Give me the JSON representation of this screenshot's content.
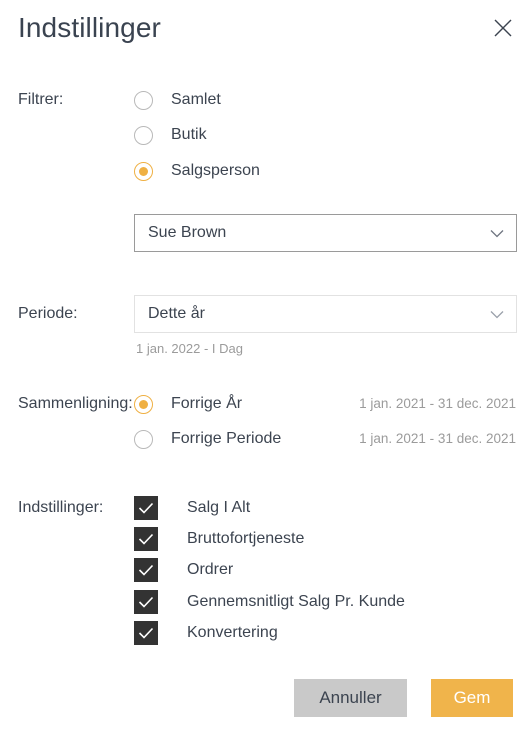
{
  "dialog": {
    "title": "Indstillinger",
    "close_icon": "close-icon"
  },
  "filter": {
    "label": "Filtrer:",
    "options": [
      {
        "label": "Samlet",
        "selected": false
      },
      {
        "label": "Butik",
        "selected": false
      },
      {
        "label": "Salgsperson",
        "selected": true
      }
    ],
    "salesperson_select": {
      "value": "Sue Brown",
      "chevron_icon": "chevron-down-icon"
    }
  },
  "period": {
    "label": "Periode:",
    "select": {
      "value": "Dette år",
      "chevron_icon": "chevron-down-icon"
    },
    "range_text": "1 jan. 2022 - I Dag"
  },
  "comparison": {
    "label": "Sammenligning:",
    "options": [
      {
        "label": "Forrige År",
        "range": "1 jan. 2021 - 31 dec. 2021",
        "selected": true
      },
      {
        "label": "Forrige Periode",
        "range": "1 jan. 2021 - 31 dec. 2021",
        "selected": false
      }
    ]
  },
  "settings": {
    "label": "Indstillinger:",
    "items": [
      {
        "label": "Salg I Alt",
        "checked": true
      },
      {
        "label": "Bruttofortjeneste",
        "checked": true
      },
      {
        "label": "Ordrer",
        "checked": true
      },
      {
        "label": "Gennemsnitligt Salg Pr. Kunde",
        "checked": true
      },
      {
        "label": "Konvertering",
        "checked": true
      }
    ],
    "check_icon": "check-icon"
  },
  "footer": {
    "cancel_label": "Annuller",
    "save_label": "Gem"
  },
  "colors": {
    "accent": "#f0b44b",
    "cancel_bg": "#c9c9c9",
    "checkbox_bg": "#333333",
    "text": "#3c4450",
    "muted_text": "#9b9b9b"
  }
}
